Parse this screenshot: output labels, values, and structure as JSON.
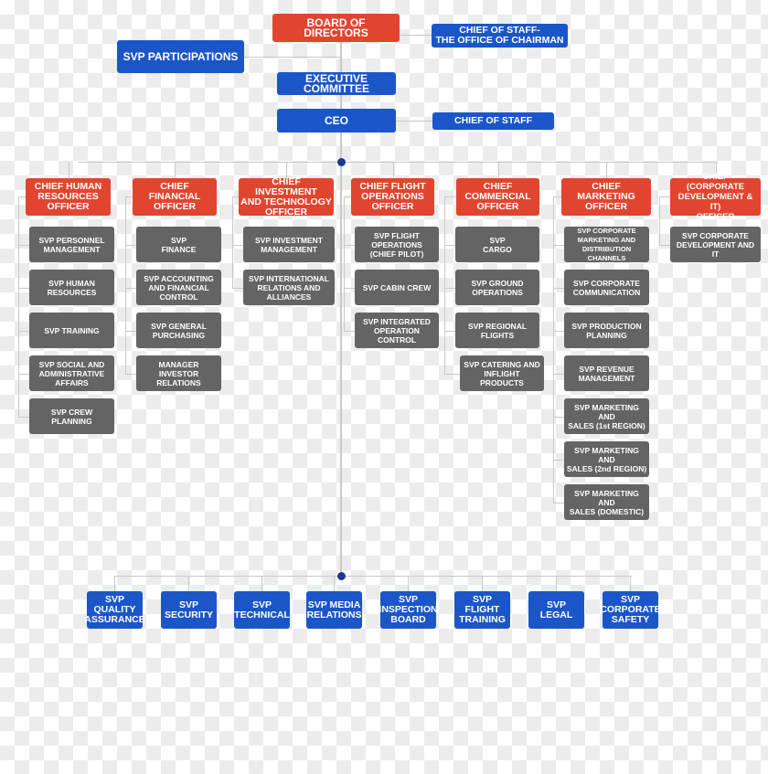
{
  "colors": {
    "leadership": "#e2452f",
    "executive": "#1b56c9",
    "svp": "#646464",
    "connector": "#c9c9c9",
    "node_dot": "#1b3a8c"
  },
  "top": {
    "board": "BOARD OF\nDIRECTORS",
    "chief_of_staff_chairman": "CHIEF OF STAFF-\nTHE OFFICE OF CHAIRMAN",
    "svp_participations": "SVP PARTICIPATIONS",
    "executive_committee": "EXECUTIVE\nCOMMITTEE",
    "ceo": "CEO",
    "chief_of_staff": "CHIEF OF STAFF"
  },
  "chiefs": [
    {
      "title": "CHIEF HUMAN\nRESOURCES\nOFFICER",
      "svps": [
        "SVP PERSONNEL\nMANAGEMENT",
        "SVP HUMAN\nRESOURCES",
        "SVP TRAINING",
        "SVP SOCIAL AND\nADMINISTRATIVE\nAFFAIRS",
        "SVP CREW\nPLANNING"
      ]
    },
    {
      "title": "CHIEF FINANCIAL\nOFFICER",
      "svps": [
        "SVP\nFINANCE",
        "SVP ACCOUNTING\nAND FINANCIAL\nCONTROL",
        "SVP GENERAL\nPURCHASING",
        "MANAGER\nINVESTOR RELATIONS"
      ]
    },
    {
      "title": "CHIEF INVESTMENT\nAND TECHNOLOGY\nOFFICER",
      "svps": [
        "SVP INVESTMENT\nMANAGEMENT",
        "SVP INTERNATIONAL\nRELATIONS  AND\nALLIANCES"
      ]
    },
    {
      "title": "CHIEF FLIGHT\nOPERATIONS\nOFFICER",
      "svps": [
        "SVP FLIGHT\nOPERATIONS\n(CHIEF PILOT)",
        "SVP CABIN CREW",
        "SVP INTEGRATED\nOPERATION\nCONTROL"
      ]
    },
    {
      "title": "CHIEF\nCOMMERCIAL\nOFFICER",
      "svps": [
        "SVP\nCARGO",
        "SVP GROUND\nOPERATIONS",
        "SVP REGIONAL\nFLIGHTS",
        "SVP CATERING AND\nINFLIGHT PRODUCTS"
      ]
    },
    {
      "title": "CHIEF MARKETING\nOFFICER",
      "svps": [
        "SVP CORPORATE\nMARKETING AND\nDISTRIBUTION\nCHANNELS",
        "SVP CORPORATE\nCOMMUNICATION",
        "SVP PRODUCTION\nPLANNING",
        "SVP REVENUE\nMANAGEMENT",
        "SVP MARKETING AND\nSALES (1st REGION)",
        "SVP MARKETING AND\nSALES (2nd REGION)",
        "SVP MARKETING AND\nSALES (DOMESTIC)"
      ]
    },
    {
      "title": "CHIEF\n(CORPORATE\nDEVELOPMENT & IT)\nOFFICER",
      "svps": [
        "SVP CORPORATE\nDEVELOPMENT  AND IT"
      ]
    }
  ],
  "bottom": [
    "SVP\nQUALITY\nASSURANCE",
    "SVP\nSECURITY",
    "SVP\nTECHNICAL",
    "SVP MEDIA\nRELATIONS",
    "SVP\nINSPECTION\nBOARD",
    "SVP\nFLIGHT\nTRAINING",
    "SVP\nLEGAL",
    "SVP\nCORPORATE\nSAFETY"
  ]
}
